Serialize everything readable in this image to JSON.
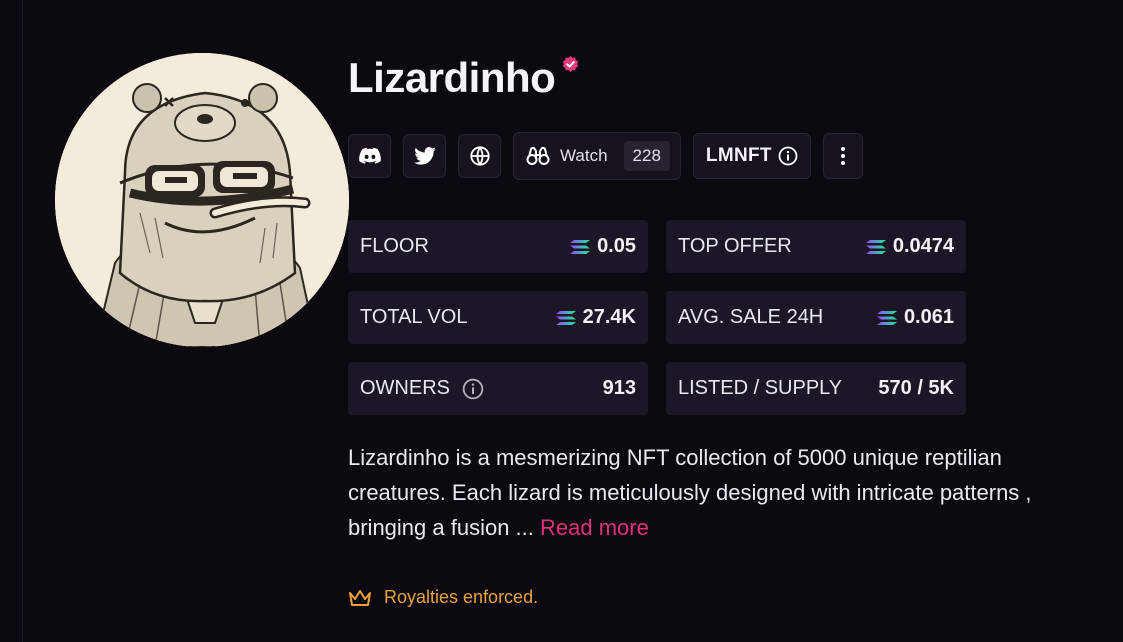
{
  "collection": {
    "name": "Lizardinho",
    "verified": true,
    "avatar_icon": "lizard-avatar-illustration"
  },
  "actions": {
    "discord_icon": "discord-icon",
    "twitter_icon": "twitter-icon",
    "website_icon": "globe-icon",
    "watch_label": "Watch",
    "watch_count": "228",
    "launchpad_label": "LMNFT",
    "more_icon": "more-vertical-icon"
  },
  "stats": {
    "floor_label": "FLOOR",
    "floor_value": "0.05",
    "top_offer_label": "TOP OFFER",
    "top_offer_value": "0.0474",
    "total_vol_label": "TOTAL VOL",
    "total_vol_value": "27.4K",
    "avg_sale_label": "AVG. SALE 24H",
    "avg_sale_value": "0.061",
    "owners_label": "OWNERS",
    "owners_value": "913",
    "listed_label": "LISTED / SUPPLY",
    "listed_value": "570 / 5K"
  },
  "description": {
    "text": "Lizardinho is a mesmerizing NFT collection of 5000 unique reptilian creatures. Each lizard is meticulously designed with intricate patterns , bringing a fusion ... ",
    "read_more": "Read more"
  },
  "royalties": {
    "text": "Royalties enforced."
  },
  "colors": {
    "background": "#0c0910",
    "card": "#1d1626",
    "accent_pink": "#e0307c",
    "royalty_gold": "#e7a23b",
    "verified_pink": "#e23a7e"
  }
}
